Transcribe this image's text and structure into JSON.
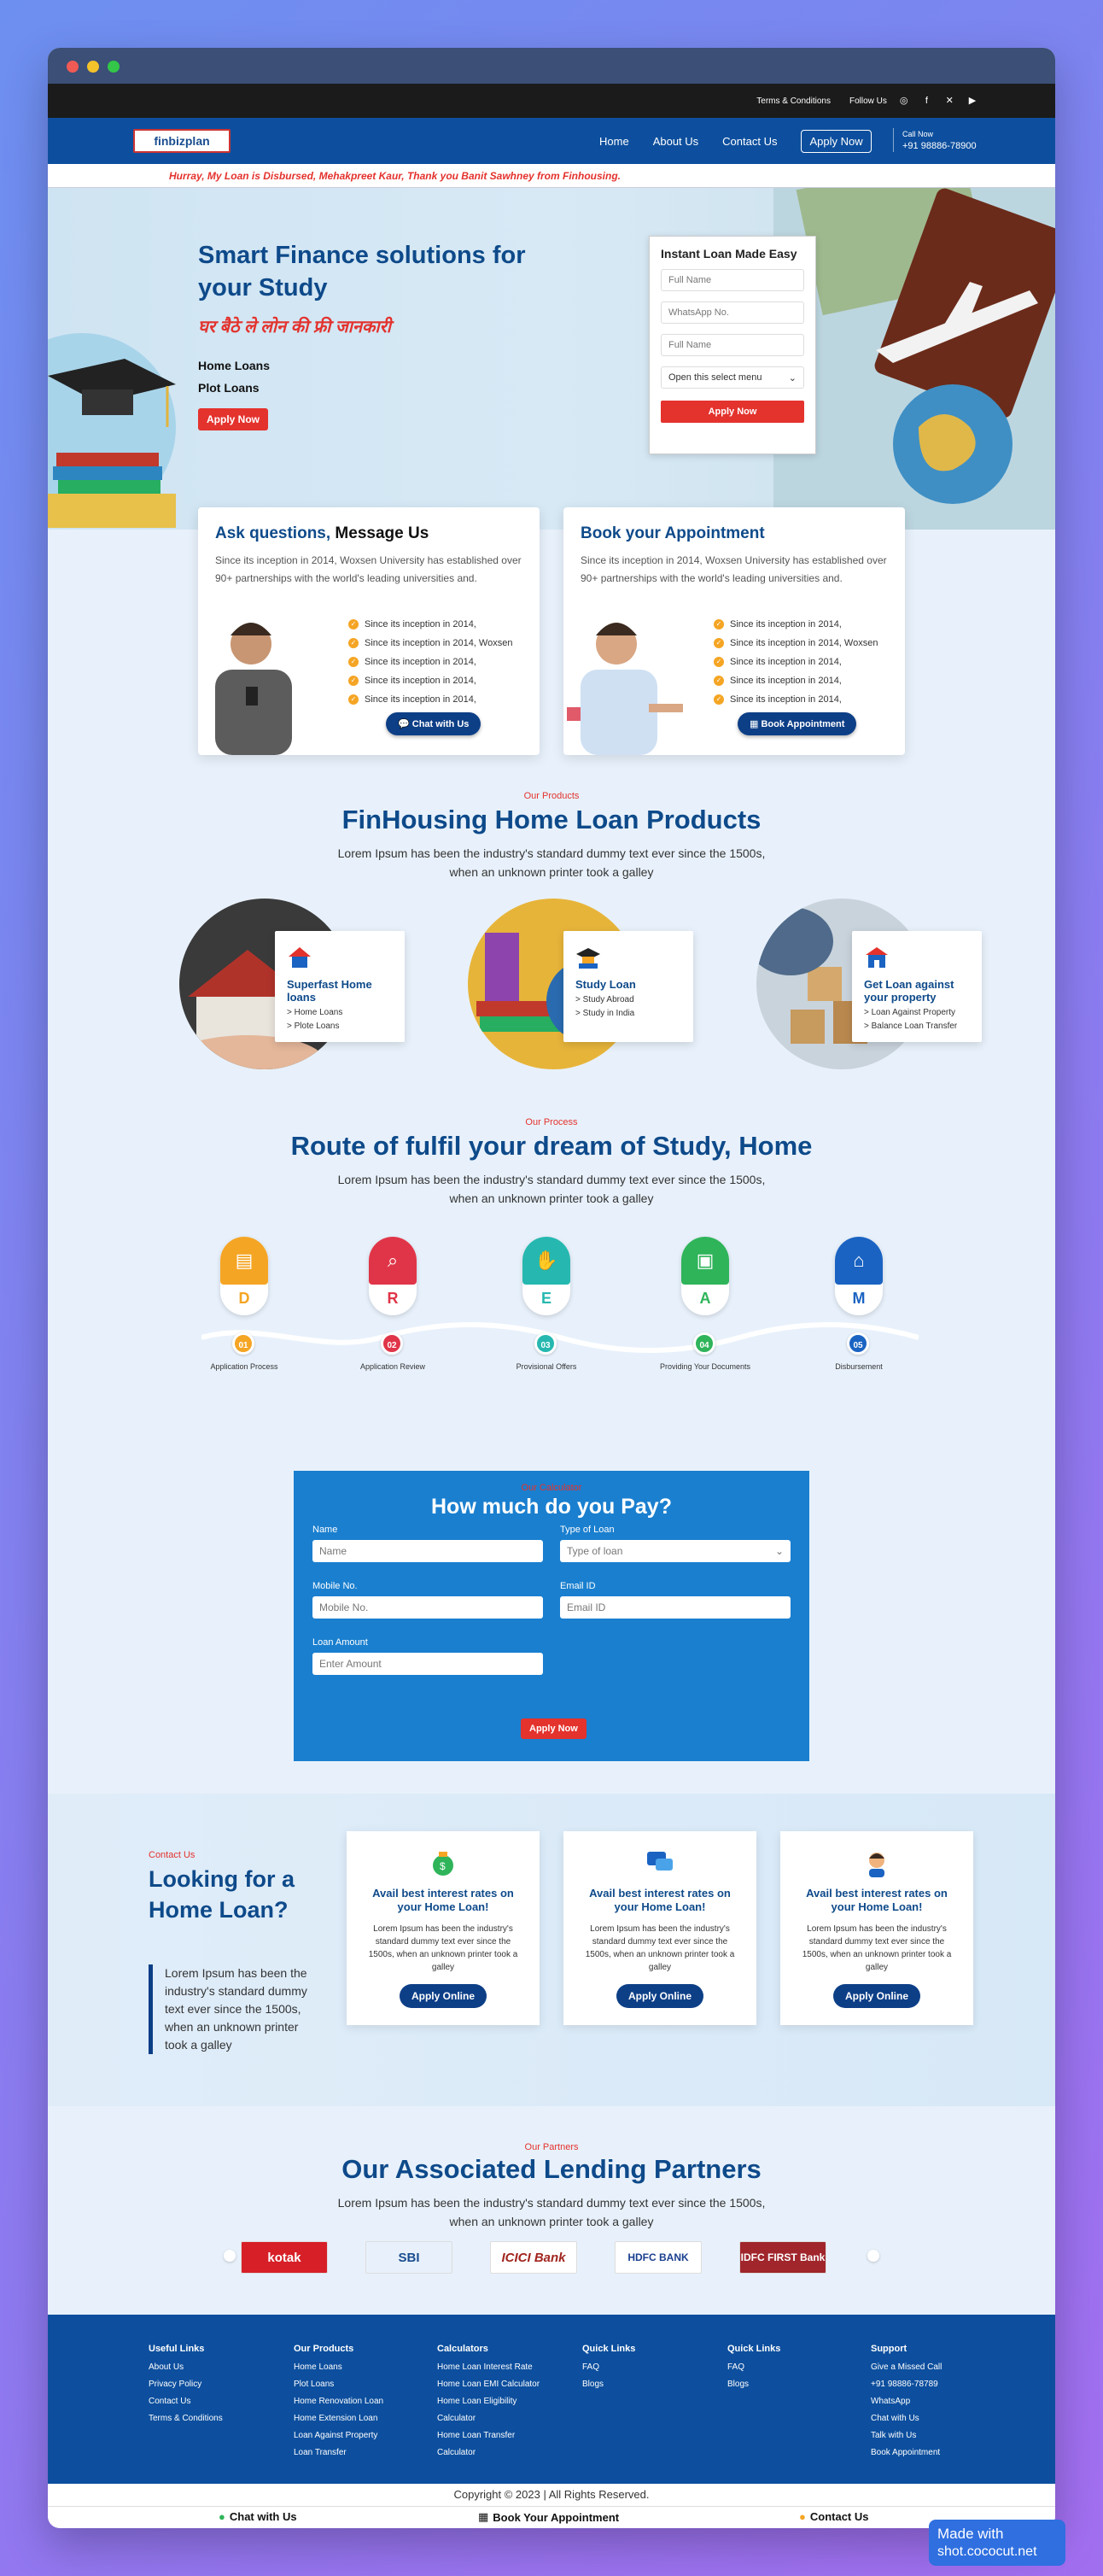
{
  "topbar": {
    "terms": "Terms & Conditions",
    "follow": "Follow Us",
    "icons": [
      "instagram-icon",
      "facebook-icon",
      "x-icon",
      "youtube-icon"
    ]
  },
  "nav": {
    "logo": "finbizplan",
    "links": [
      "Home",
      "About Us",
      "Contact Us"
    ],
    "apply": "Apply Now",
    "call_label": "Call Now",
    "call_number": "+91 98886-78900"
  },
  "marquee": "Hurray, My Loan is Disbursed, Mehakpreet Kaur, Thank you Banit Sawhney from Finhousing.",
  "hero": {
    "title": "Smart Finance solutions for your Study",
    "hindi": "घर बैठे ले लोन की फ्री जानकारी",
    "items": [
      "Home Loans",
      "Plot Loans"
    ],
    "apply": "Apply Now"
  },
  "quick_form": {
    "title": "Instant Loan Made Easy",
    "fields": [
      "Full Name",
      "WhatsApp No.",
      "Full Name"
    ],
    "select": "Open this select menu",
    "button": "Apply Now"
  },
  "cards": [
    {
      "title_a": "Ask questions,",
      "title_b": " Message Us",
      "text": "Since its inception in 2014, Woxsen University has established over 90+ partnerships with the world's leading universities and.",
      "points": [
        "Since its inception in 2014,",
        "Since its inception in 2014, Woxsen",
        "Since its inception in 2014,",
        "Since its inception in 2014,",
        "Since its inception in 2014,"
      ],
      "button": "Chat with Us"
    },
    {
      "title_a": "Book your Appointment",
      "title_b": "",
      "text": "Since its inception in 2014, Woxsen University has established over 90+ partnerships with the world's leading universities and.",
      "points": [
        "Since its inception in 2014,",
        "Since its inception in 2014, Woxsen",
        "Since its inception in 2014,",
        "Since its inception in 2014,",
        "Since its inception in 2014,"
      ],
      "button": "Book Appointment"
    }
  ],
  "products": {
    "tag": "Our Products",
    "title": "FinHousing Home Loan Products",
    "sub": "Lorem Ipsum has been the industry's standard dummy text ever since the 1500s, when an unknown printer took a galley",
    "items": [
      {
        "title": "Superfast Home loans",
        "lines": [
          "Home Loans",
          "Plote Loans"
        ]
      },
      {
        "title": "Study Loan",
        "lines": [
          "Study Abroad",
          "Study in India"
        ]
      },
      {
        "title": "Get Loan against your property",
        "lines": [
          "Loan Against Property",
          "Balance Loan Transfer"
        ]
      }
    ]
  },
  "process": {
    "tag": "Our Process",
    "title": "Route of fulfil your dream of Study, Home",
    "sub": "Lorem Ipsum has been the industry's standard dummy text ever since the 1500s, when an unknown printer took a galley",
    "steps": [
      {
        "letter": "D",
        "num": "01",
        "label": "Application Process",
        "color": "#f5a524"
      },
      {
        "letter": "R",
        "num": "02",
        "label": "Application Review",
        "color": "#e03548"
      },
      {
        "letter": "E",
        "num": "03",
        "label": "Provisional Offers",
        "color": "#26b8b0"
      },
      {
        "letter": "A",
        "num": "04",
        "label": "Providing Your Documents",
        "color": "#2fb45a"
      },
      {
        "letter": "M",
        "num": "05",
        "label": "Disbursement",
        "color": "#1a63c2"
      }
    ]
  },
  "calculator": {
    "tag": "Our Calculator",
    "title": "How much do you Pay?",
    "fields": [
      {
        "label": "Name",
        "placeholder": "Name"
      },
      {
        "label": "Type of Loan",
        "placeholder": "Type of loan"
      },
      {
        "label": "Mobile No.",
        "placeholder": "Mobile No."
      },
      {
        "label": "Email ID",
        "placeholder": "Email ID"
      },
      {
        "label": "Loan Amount",
        "placeholder": "Enter Amount"
      }
    ],
    "button": "Apply Now"
  },
  "contact": {
    "tag": "Contact Us",
    "title": "Looking for a Home Loan?",
    "text": "Lorem Ipsum has been the industry's standard dummy text ever since the 1500s, when an unknown printer took a galley",
    "offers": [
      {
        "title": "Avail best interest rates on your Home Loan!",
        "text": "Lorem Ipsum has been the industry's standard dummy text ever since the 1500s, when an unknown printer took a galley",
        "button": "Apply Online"
      },
      {
        "title": "Avail best interest rates on your Home Loan!",
        "text": "Lorem Ipsum has been the industry's standard dummy text ever since the 1500s, when an unknown printer took a galley",
        "button": "Apply Online"
      },
      {
        "title": "Avail best interest rates on your Home Loan!",
        "text": "Lorem Ipsum has been the industry's standard dummy text ever since the 1500s, when an unknown printer took a galley",
        "button": "Apply Online"
      }
    ]
  },
  "partners": {
    "tag": "Our Partners",
    "title": "Our Associated Lending Partners",
    "sub": "Lorem Ipsum has been the industry's standard dummy text ever since the 1500s, when an unknown printer took a galley",
    "logos": [
      "kotak",
      "SBI",
      "ICICI Bank",
      "HDFC BANK",
      "IDFC FIRST Bank"
    ]
  },
  "footer": {
    "cols": [
      {
        "title": "Useful Links",
        "items": [
          "About Us",
          "Privacy Policy",
          "Contact Us",
          "Terms & Conditions"
        ]
      },
      {
        "title": "Our Products",
        "items": [
          "Home Loans",
          "Plot Loans",
          "Home Renovation Loan",
          "Home Extension Loan",
          "Loan Against Property",
          "Loan Transfer"
        ]
      },
      {
        "title": "Calculators",
        "items": [
          "Home Loan Interest Rate",
          "Home Loan EMI Calculator",
          "Home Loan Eligibility",
          "Calculator",
          "Home Loan Transfer",
          "Calculator"
        ]
      },
      {
        "title": "Quick Links",
        "items": [
          "FAQ",
          "Blogs"
        ]
      },
      {
        "title": "Quick Links",
        "items": [
          "FAQ",
          "Blogs"
        ]
      },
      {
        "title": "Support",
        "items": [
          "Give a Missed Call",
          "+91 98886-78789",
          "WhatsApp",
          "Chat with Us",
          "Talk with Us",
          "Book Appointment"
        ]
      }
    ],
    "copyright": "Copyright © 2023 | All Rights Reserved."
  },
  "bottombar": {
    "chat": "Chat with Us",
    "book": "Book Your Appointment",
    "contact": "Contact Us"
  },
  "badge": {
    "line1": "Made with",
    "line2": "shot.cococut.net"
  }
}
